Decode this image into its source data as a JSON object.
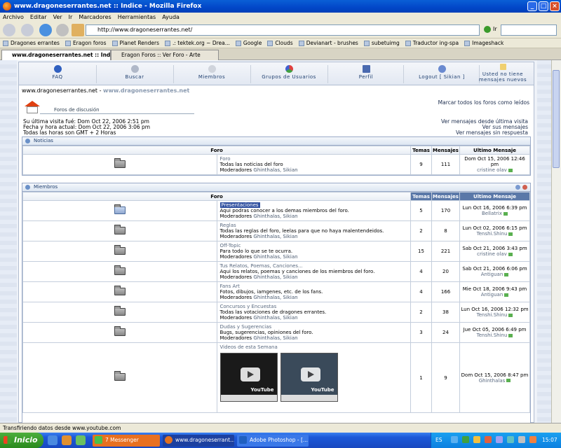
{
  "window": {
    "title": "www.dragoneserrantes.net :: Indice - Mozilla Firefox"
  },
  "menu": [
    "Archivo",
    "Editar",
    "Ver",
    "Ir",
    "Marcadores",
    "Herramientas",
    "Ayuda"
  ],
  "url": "http://www.dragoneserrantes.net/",
  "go_label": "Ir",
  "bookmarks": [
    "Dragones errantes",
    "Eragon foros",
    "Planet Renders",
    ".: tektek.org ~ Drea...",
    "Google",
    "Clouds",
    "Devianart - brushes",
    "subetuimg",
    "Traductor ing-spa",
    "Imageshack"
  ],
  "tabs": [
    "www.dragoneserrantes.net :: Indice",
    "Eragon Foros :: Ver Foro - Arte"
  ],
  "forum_nav": {
    "faq": "FAQ",
    "buscar": "Buscar",
    "miembros": "Miembros",
    "grupos": "Grupos de Usuarios",
    "perfil": "Perfil",
    "logout": "Logout [ Sikian ]",
    "mensajes": "Usted no tiene mensajes nuevos"
  },
  "breadcrumb": {
    "site1": "www.dragoneserrantes.net -",
    "site2": "www.dragoneserrantes.net"
  },
  "mark_all": "Marcar todos los foros como leídos",
  "foros_label": "Foros de discusión",
  "info": {
    "last_visit": "Su última visita fué: Dom Oct 22, 2006 2:51 pm",
    "now": "Fecha y hora actual: Dom Oct 22, 2006 3:06 pm",
    "tz": "Todas las horas son GMT + 2 Horas",
    "new_posts": "Ver mensajes desde última visita",
    "your_posts": "Ver sus mensajes",
    "unanswered": "Ver mensajes sin respuesta"
  },
  "headers": {
    "foro": "Foro",
    "temas": "Temas",
    "mensajes": "Mensajes",
    "ultimo": "Ultimo Mensaje"
  },
  "categories": [
    {
      "name": "Noticias",
      "forums": [
        {
          "name": "Foro",
          "desc": "Todas las noticias del foro",
          "mods_label": "Moderadores",
          "mods": "Ghinthalas, Sikian",
          "temas": "9",
          "mensajes": "111",
          "last_date": "Dom Oct 15, 2006 12:46 pm",
          "last_user": "cristine olav"
        }
      ]
    },
    {
      "name": "Miembros",
      "forums": [
        {
          "name": "Presentaciones",
          "desc": "Aqui podras conocer a los demas miembros del foro.",
          "mods_label": "Moderadores",
          "mods": "Ghinthalas, Sikian",
          "temas": "5",
          "mensajes": "170",
          "last_date": "Lun Oct 16, 2006 6:39 pm",
          "last_user": "Bellatrix"
        },
        {
          "name": "Reglas",
          "desc": "Todas las reglas del foro, leelas para que no haya malentendeidos.",
          "mods_label": "Moderadores",
          "mods": "Ghinthalas, Sikian",
          "temas": "2",
          "mensajes": "8",
          "last_date": "Lun Oct 02, 2006 6:15 pm",
          "last_user": "Tenshi.Shinu"
        },
        {
          "name": "Off-Topic",
          "desc": "Para todo lo que se te ocurra.",
          "mods_label": "Moderadores",
          "mods": "Ghinthalas, Sikian",
          "temas": "15",
          "mensajes": "221",
          "last_date": "Sab Oct 21, 2006 3:43 pm",
          "last_user": "cristine olav"
        },
        {
          "name": "Tus Relatos, Poemas, Canciones...",
          "desc": "Aqui los relatos, poemas y canciones de los miembros del foro.",
          "mods_label": "Moderadores",
          "mods": "Ghinthalas, Sikian",
          "temas": "4",
          "mensajes": "20",
          "last_date": "Sab Oct 21, 2006 6:06 pm",
          "last_user": "Antiguan"
        },
        {
          "name": "Fans Art",
          "desc": "Fotos, dibujos, iamgenes, etc. de los fans.",
          "mods_label": "Moderadores",
          "mods": "Ghinthalas, Sikian",
          "temas": "4",
          "mensajes": "166",
          "last_date": "Mie Oct 18, 2006 9:43 pm",
          "last_user": "Antiguan"
        },
        {
          "name": "Concursos y Encuestas",
          "desc": "Todas las votaciones de dragones errantes.",
          "mods_label": "Moderadores",
          "mods": "Ghinthalas, Sikian",
          "temas": "2",
          "mensajes": "38",
          "last_date": "Lun Oct 16, 2006 12:32 pm",
          "last_user": "Tenshi.Shinu"
        },
        {
          "name": "Dudas y Sugerencias",
          "desc": "Bugs, sugerencias, opiniones del foro.",
          "mods_label": "Moderadores",
          "mods": "Ghinthalas, Sikian",
          "temas": "3",
          "mensajes": "24",
          "last_date": "Jue Oct 05, 2006 6:49 pm",
          "last_user": "Tenshi.Shinu"
        },
        {
          "name": "Videos de esta Semana",
          "desc": "",
          "mods_label": "",
          "mods": "",
          "temas": "1",
          "mensajes": "9",
          "last_date": "Dom Oct 15, 2006 8:47 pm",
          "last_user": "Ghinthalas"
        }
      ]
    }
  ],
  "status": "Transfiriendo datos desde www.youtube.com",
  "taskbar": {
    "start": "Inicio",
    "items": [
      "7 Messenger",
      "www.dragoneserrant...",
      "Adobe Photoshop - [..."
    ],
    "lang": "ES",
    "time": "15:07"
  }
}
